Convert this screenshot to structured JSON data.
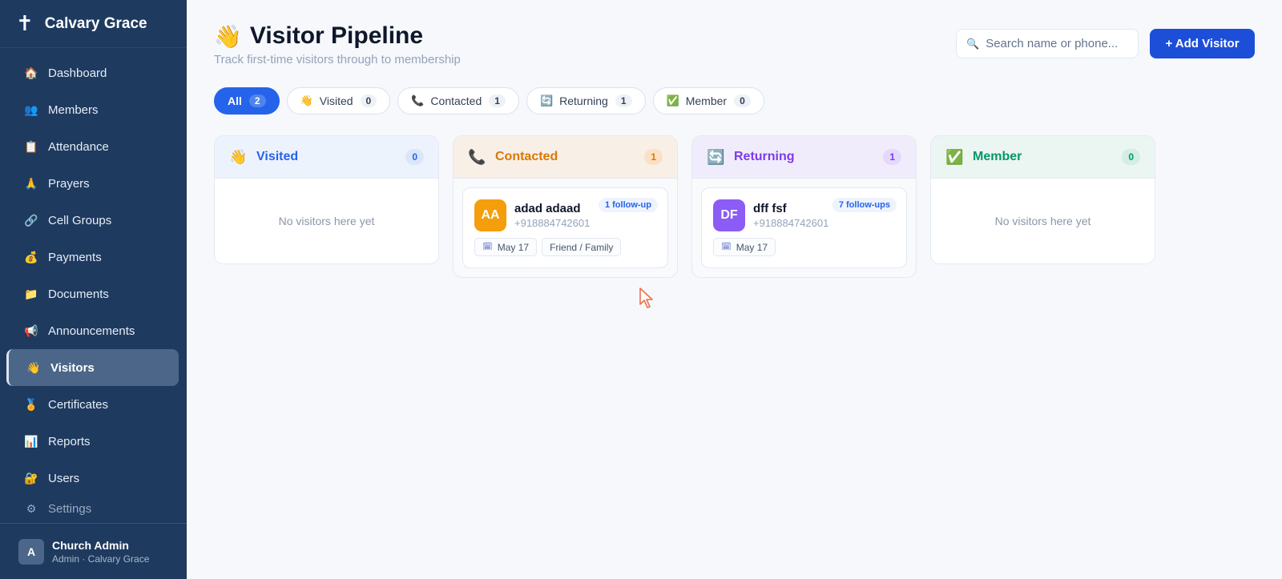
{
  "app": {
    "brand_icon": "✝",
    "brand_name": "Calvary Grace"
  },
  "sidebar": {
    "items": [
      {
        "icon": "🏠",
        "label": "Dashboard"
      },
      {
        "icon": "👥",
        "label": "Members"
      },
      {
        "icon": "📋",
        "label": "Attendance"
      },
      {
        "icon": "🙏",
        "label": "Prayers"
      },
      {
        "icon": "🔗",
        "label": "Cell Groups"
      },
      {
        "icon": "💰",
        "label": "Payments"
      },
      {
        "icon": "📁",
        "label": "Documents"
      },
      {
        "icon": "📢",
        "label": "Announcements"
      },
      {
        "icon": "👋",
        "label": "Visitors"
      },
      {
        "icon": "🏅",
        "label": "Certificates"
      },
      {
        "icon": "📊",
        "label": "Reports"
      },
      {
        "icon": "🔐",
        "label": "Users"
      },
      {
        "icon": "⚙",
        "label": "Settings"
      }
    ],
    "active_index": 8
  },
  "user": {
    "initial": "A",
    "name": "Church Admin",
    "role": "Admin · Calvary Grace"
  },
  "page": {
    "emoji": "👋",
    "title": "Visitor Pipeline",
    "subtitle": "Track first-time visitors through to membership",
    "search_placeholder": "Search name or phone...",
    "add_label": "+ Add Visitor"
  },
  "filters": [
    {
      "icon": "",
      "label": "All",
      "count": "2"
    },
    {
      "icon": "👋",
      "label": "Visited",
      "count": "0"
    },
    {
      "icon": "📞",
      "label": "Contacted",
      "count": "1"
    },
    {
      "icon": "🔄",
      "label": "Returning",
      "count": "1"
    },
    {
      "icon": "✅",
      "label": "Member",
      "count": "0"
    }
  ],
  "columns": [
    {
      "icon": "👋",
      "name": "Visited",
      "count": "0",
      "empty_text": "No visitors here yet",
      "color": "#2563eb",
      "head_bg": "#edf3fd",
      "badge_bg": "#dbe6fb"
    },
    {
      "icon": "📞",
      "name": "Contacted",
      "count": "1",
      "color": "#d97706",
      "head_bg": "#f8efe7",
      "badge_bg": "#fbe0c6"
    },
    {
      "icon": "🔄",
      "name": "Returning",
      "count": "1",
      "color": "#7c3aed",
      "head_bg": "#f1ecfb",
      "badge_bg": "#e5d9fb"
    },
    {
      "icon": "✅",
      "name": "Member",
      "count": "0",
      "empty_text": "No visitors here yet",
      "color": "#059669",
      "head_bg": "#ebf5f2",
      "badge_bg": "#d3eee4"
    }
  ],
  "cards": [
    {
      "initials": "AA",
      "name": "adad adaad",
      "phone": "+918884742601",
      "followups": "1 follow-up",
      "date": "May 17",
      "source": "Friend / Family",
      "avatar_color": "#f59e0b"
    },
    {
      "initials": "DF",
      "name": "dff fsf",
      "phone": "+918884742601",
      "followups": "7 follow-ups",
      "date": "May 17",
      "avatar_color": "#8b5cf6"
    }
  ],
  "icons": {
    "search": "🔍",
    "calendar": "🗓",
    "cursor": "mouse-pointer"
  }
}
